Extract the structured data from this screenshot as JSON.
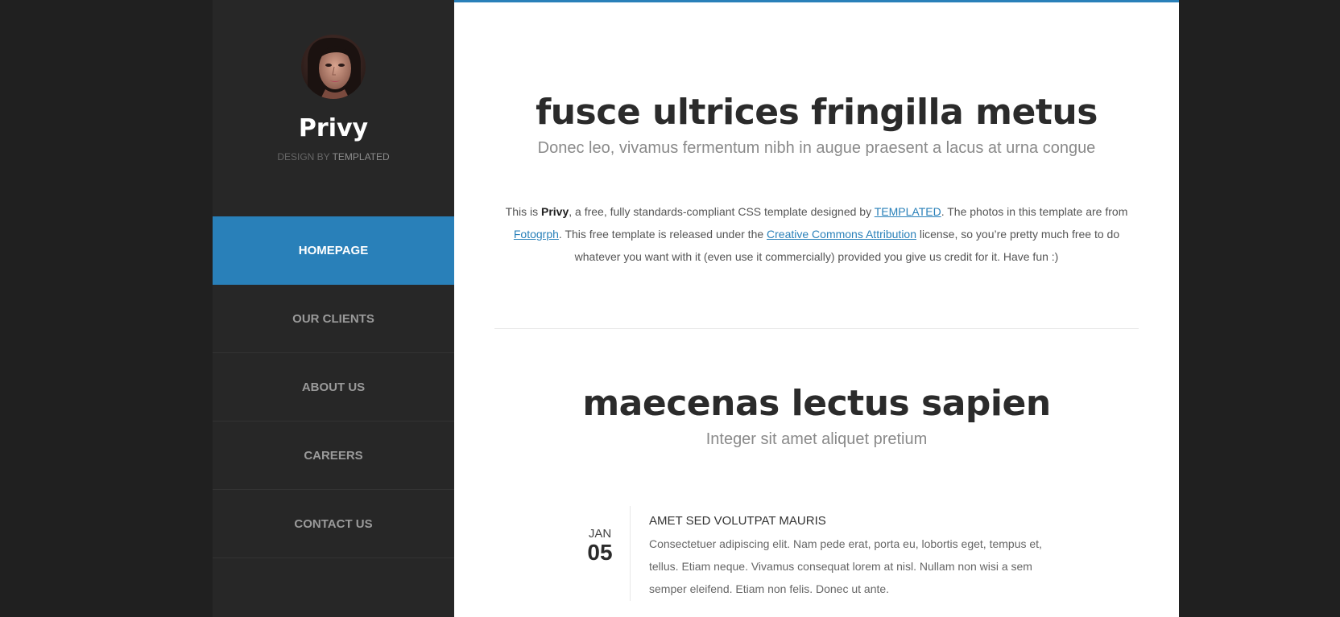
{
  "sidebar": {
    "avatar_alt": "profile photo",
    "title": "Privy",
    "byline_prefix": "DESIGN BY ",
    "byline_brand": "TEMPLATED",
    "nav": [
      {
        "label": "HOMEPAGE",
        "active": true
      },
      {
        "label": "OUR CLIENTS",
        "active": false
      },
      {
        "label": "ABOUT US",
        "active": false
      },
      {
        "label": "CAREERS",
        "active": false
      },
      {
        "label": "CONTACT US",
        "active": false
      }
    ]
  },
  "main": {
    "section1": {
      "title": "fusce ultrices fringilla metus",
      "subtitle": "Donec leo, vivamus fermentum nibh in augue praesent a lacus at urna congue",
      "intro": {
        "t1": "This is ",
        "brand": "Privy",
        "t2": ", a free, fully standards-compliant CSS template designed by ",
        "link1": "TEMPLATED",
        "t3": ". The photos in this template are from ",
        "link2": "Fotogrph",
        "t4": ". This free template is released under the ",
        "link3": "Creative Commons Attribution",
        "t5": " license, so you’re pretty much free to do whatever you want with it (even use it commercially) provided you give us credit for it. Have fun :)"
      }
    },
    "section2": {
      "title": "maecenas lectus sapien",
      "subtitle": "Integer sit amet aliquet pretium",
      "event": {
        "month": "JAN",
        "day": "05",
        "title": "AMET SED VOLUTPAT MAURIS",
        "text": "Consectetuer adipiscing elit. Nam pede erat, porta eu, lobortis eget, tempus et, tellus. Etiam neque. Vivamus consequat lorem at nisl. Nullam non wisi a sem semper eleifend. Etiam non felis. Donec ut ante."
      }
    }
  },
  "colors": {
    "accent": "#2980b9",
    "sidebar_bg": "#272727",
    "page_bg": "#202020",
    "content_bg": "#ffffff"
  }
}
